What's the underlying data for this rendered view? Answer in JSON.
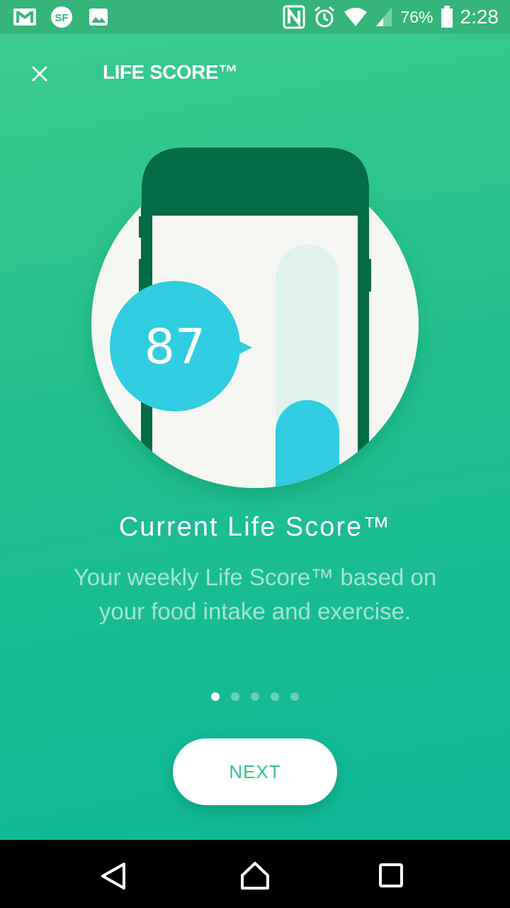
{
  "status_bar": {
    "battery": "76%",
    "time": "2:28",
    "icons": [
      "gmail-icon",
      "sf-icon",
      "image-icon",
      "nfc-icon",
      "alarm-icon",
      "wifi-icon",
      "signal-icon",
      "battery-icon"
    ]
  },
  "header": {
    "title": "LIFE SCORE™",
    "close_icon": "close-icon"
  },
  "illustration": {
    "score": "87",
    "bar_fill_fraction": 0.55
  },
  "content": {
    "heading": "Current Life Score™",
    "description": "Your weekly Life Score™ based on your food intake and exercise."
  },
  "pagination": {
    "total": 5,
    "active_index": 0
  },
  "next_button": {
    "label": "NEXT"
  },
  "nav_bar": {
    "icons": [
      "back-icon",
      "home-icon",
      "recents-icon"
    ]
  },
  "colors": {
    "accent": "#36c587",
    "score_bubble": "#30cde0",
    "phone_dark": "#036b46",
    "screen_bg": "#f6f7f3"
  }
}
